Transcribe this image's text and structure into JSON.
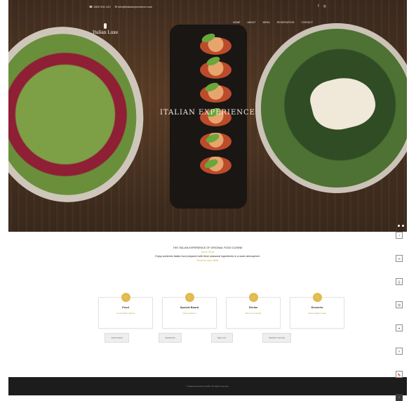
{
  "topbar": {
    "phone": "☎ 1800 900 120",
    "email": "✉ info@italianexperience.com",
    "social_1": "f",
    "social_2": "◎"
  },
  "logo": {
    "text": "Italian Luxe"
  },
  "nav": {
    "items": [
      "HOME",
      "ABOUT",
      "MENU",
      "RESERVATION",
      "CONTACT"
    ]
  },
  "hero": {
    "brand": "ITALIAN EXPERIENCE"
  },
  "intro": {
    "line1": "THE ITALIAN EXPERIENCE OF ORIGINAL FOOD CUISINE",
    "line2": "Since 2016",
    "line3": "Enjoy authentic Italian food prepared with fresh seasonal ingredients in a warm atmosphere",
    "line4": "Reserve your table"
  },
  "cards": [
    {
      "title": "Food",
      "sub": "Fresh Italian dishes",
      "button": "VIEW MENU"
    },
    {
      "title": "Special Board",
      "sub": "Chef selection",
      "button": "RESERVE"
    },
    {
      "title": "Drinks",
      "sub": "Wine & Cocktails",
      "button": "SEE LIST"
    },
    {
      "title": "Desserts",
      "sub": "Sweet Italian treats",
      "button": "ORDER ONLINE"
    }
  ],
  "footer": {
    "copyright": "© Italian Experience 2019. All rights reserved."
  },
  "side_icons": [
    "share",
    "mail",
    "print",
    "link",
    "like",
    "comment",
    "bookmark",
    "top"
  ]
}
